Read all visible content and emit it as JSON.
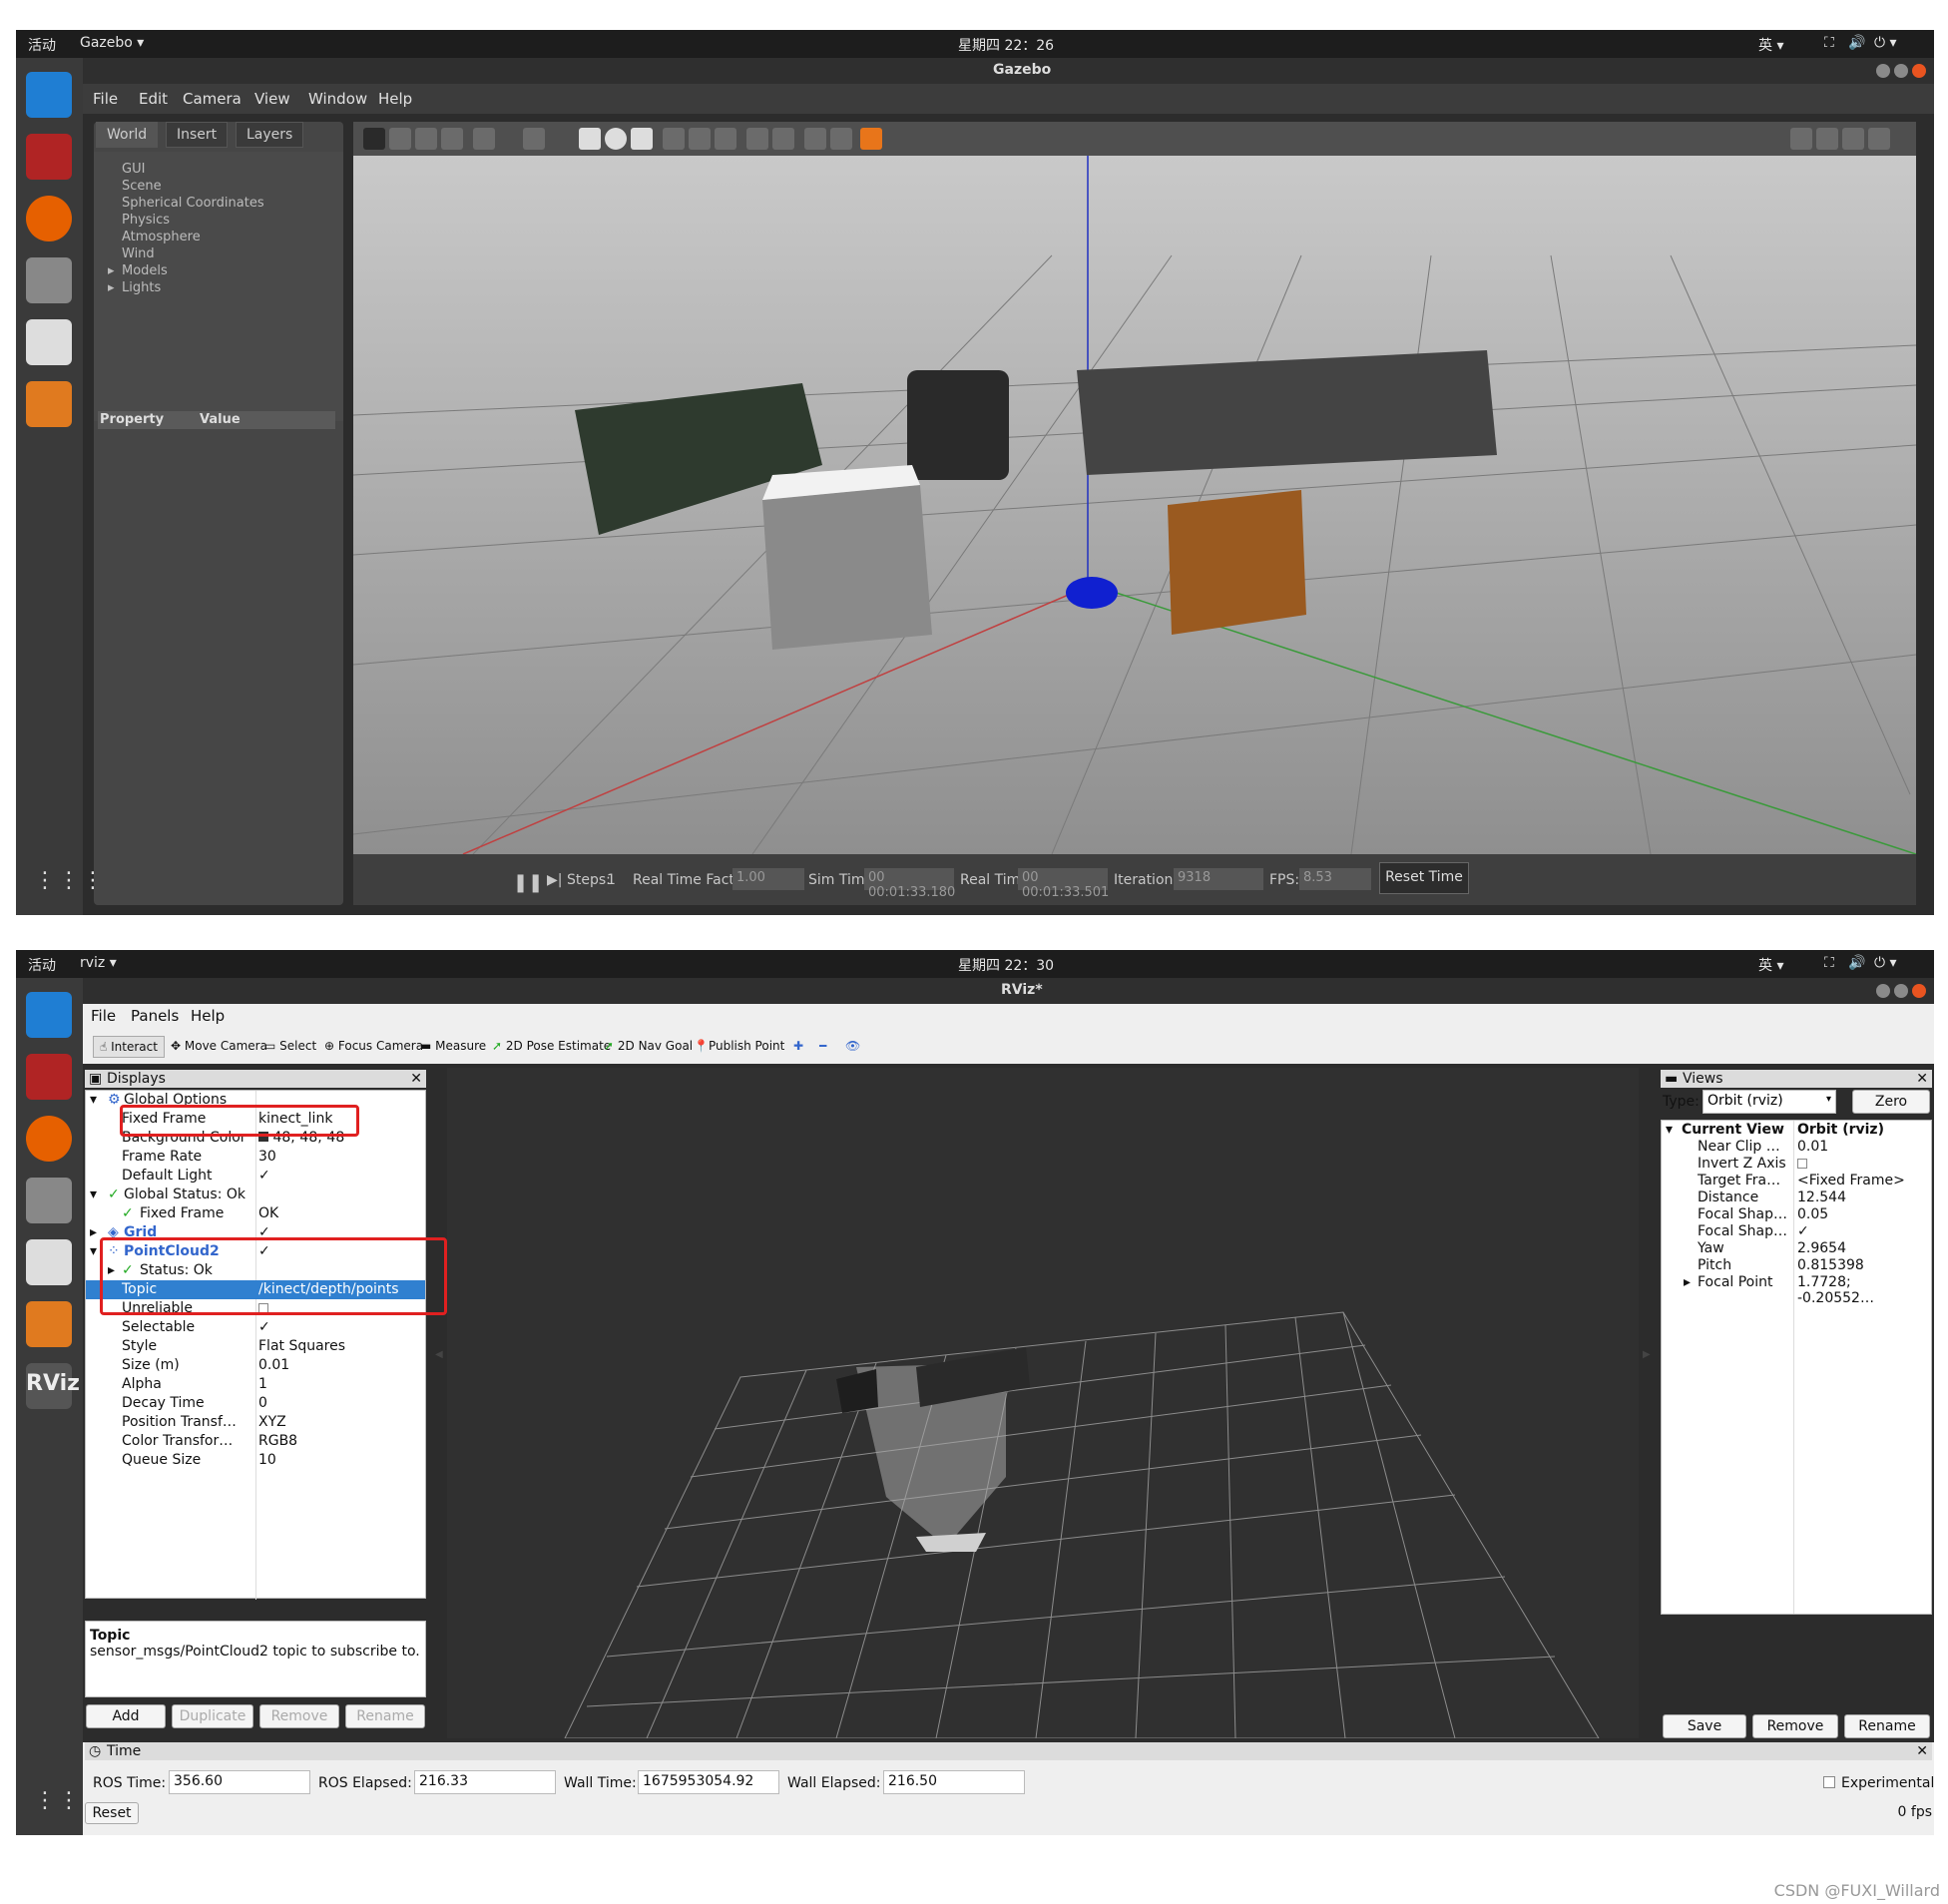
{
  "gazebo": {
    "topbar": {
      "activities": "活动",
      "app": "Gazebo ▾",
      "clock": "星期四 22：26",
      "ime": "英 ▾"
    },
    "title": "Gazebo",
    "menu": [
      "File",
      "Edit",
      "Camera",
      "View",
      "Window",
      "Help"
    ],
    "tabs": [
      "World",
      "Insert",
      "Layers"
    ],
    "tree": [
      "GUI",
      "Scene",
      "Spherical Coordinates",
      "Physics",
      "Atmosphere",
      "Wind",
      "Models",
      "Lights"
    ],
    "tree_expanders": [
      "Models",
      "Lights"
    ],
    "prop_header": {
      "property": "Property",
      "value": "Value"
    },
    "status": {
      "steps_label": "Steps:",
      "steps_value": "1",
      "rtf_label": "Real Time Factor:",
      "rtf_value": "1.00",
      "sim_label": "Sim Time:",
      "sim_value": "00 00:01:33.180",
      "real_label": "Real Time:",
      "real_value": "00 00:01:33.501",
      "iter_label": "Iterations:",
      "iter_value": "9318",
      "fps_label": "FPS:",
      "fps_value": "8.53",
      "reset": "Reset Time"
    }
  },
  "rviz": {
    "topbar": {
      "activities": "活动",
      "app": "rviz ▾",
      "clock": "星期四 22：30",
      "ime": "英 ▾"
    },
    "title": "RViz*",
    "menu": [
      "File",
      "Panels",
      "Help"
    ],
    "tools": [
      "Interact",
      "Move Camera",
      "Select",
      "Focus Camera",
      "Measure",
      "2D Pose Estimate",
      "2D Nav Goal",
      "Publish Point"
    ],
    "displays_title": "Displays",
    "displays": [
      {
        "key": "Global Options",
        "value": ""
      },
      {
        "key": "Fixed Frame",
        "value": "kinect_link"
      },
      {
        "key": "Background Color",
        "value": "48; 48; 48"
      },
      {
        "key": "Frame Rate",
        "value": "30"
      },
      {
        "key": "Default Light",
        "value": "✓"
      },
      {
        "key": "Global Status: Ok",
        "value": ""
      },
      {
        "key": "Fixed Frame",
        "value": "OK"
      },
      {
        "key": "Grid",
        "value": "✓"
      },
      {
        "key": "PointCloud2",
        "value": "✓"
      },
      {
        "key": "Status: Ok",
        "value": ""
      },
      {
        "key": "Topic",
        "value": "/kinect/depth/points"
      },
      {
        "key": "Unreliable",
        "value": ""
      },
      {
        "key": "Selectable",
        "value": "✓"
      },
      {
        "key": "Style",
        "value": "Flat Squares"
      },
      {
        "key": "Size (m)",
        "value": "0.01"
      },
      {
        "key": "Alpha",
        "value": "1"
      },
      {
        "key": "Decay Time",
        "value": "0"
      },
      {
        "key": "Position Transf…",
        "value": "XYZ"
      },
      {
        "key": "Color Transfor…",
        "value": "RGB8"
      },
      {
        "key": "Queue Size",
        "value": "10"
      }
    ],
    "desc_title": "Topic",
    "desc_text": "sensor_msgs/PointCloud2 topic to subscribe to.",
    "display_buttons": [
      "Add",
      "Duplicate",
      "Remove",
      "Rename"
    ],
    "views_title": "Views",
    "views_type_label": "Type:",
    "views_type_value": "Orbit (rviz)",
    "views_zero": "Zero",
    "views_rows": [
      {
        "key": "Current View",
        "value": "Orbit (rviz)"
      },
      {
        "key": "Near Clip …",
        "value": "0.01"
      },
      {
        "key": "Invert Z Axis",
        "value": ""
      },
      {
        "key": "Target Fra…",
        "value": "<Fixed Frame>"
      },
      {
        "key": "Distance",
        "value": "12.544"
      },
      {
        "key": "Focal Shap…",
        "value": "0.05"
      },
      {
        "key": "Focal Shap…",
        "value": "✓"
      },
      {
        "key": "Yaw",
        "value": "2.9654"
      },
      {
        "key": "Pitch",
        "value": "0.815398"
      },
      {
        "key": "Focal Point",
        "value": "1.7728; -0.20552…"
      }
    ],
    "views_buttons": [
      "Save",
      "Remove",
      "Rename"
    ],
    "time_title": "Time",
    "ros_time_label": "ROS Time:",
    "ros_time": "356.60",
    "ros_elapsed_label": "ROS Elapsed:",
    "ros_elapsed": "216.33",
    "wall_time_label": "Wall Time:",
    "wall_time": "1675953054.92",
    "wall_elapsed_label": "Wall Elapsed:",
    "wall_elapsed": "216.50",
    "experimental": "Experimental",
    "reset": "Reset",
    "fps": "0 fps"
  },
  "watermark": "CSDN @FUXI_Willard"
}
